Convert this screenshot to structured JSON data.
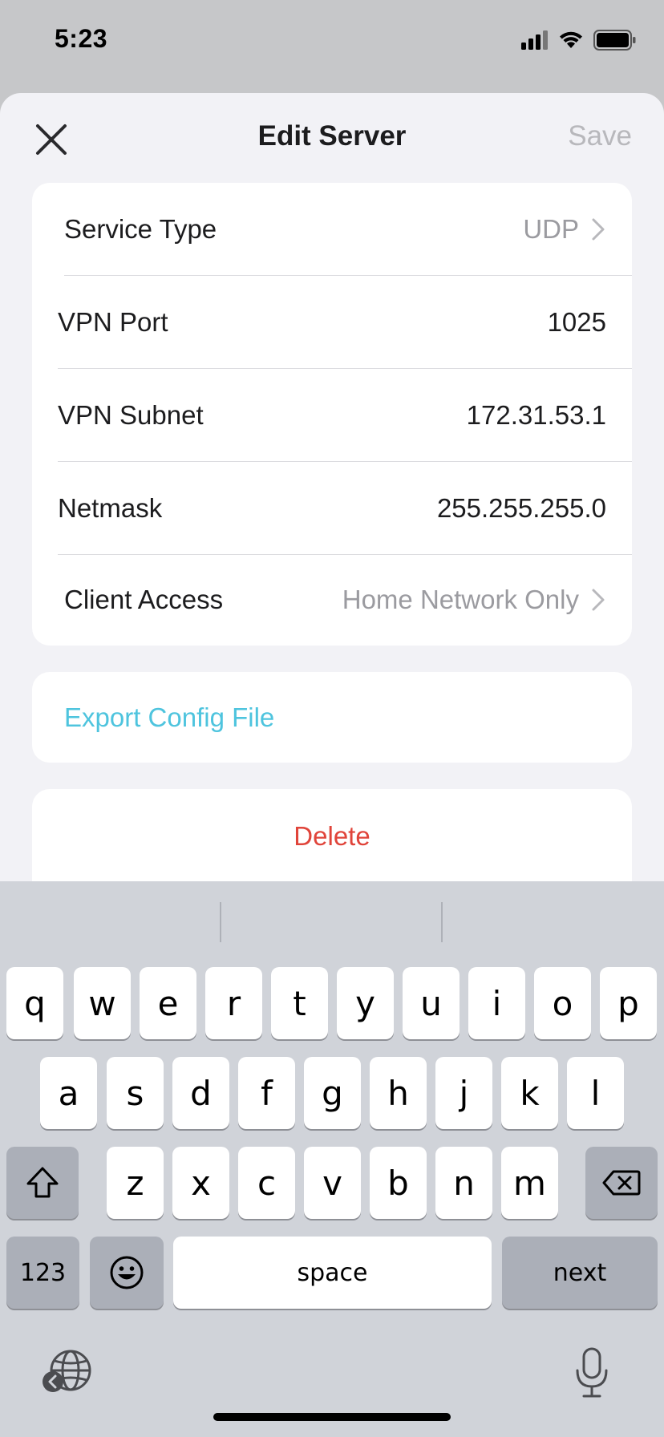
{
  "status": {
    "time": "5:23"
  },
  "nav": {
    "title": "Edit Server",
    "save_label": "Save"
  },
  "settings": [
    {
      "label": "Service Type",
      "value": "UDP",
      "has_chevron": true
    },
    {
      "label": "VPN Port",
      "value": "1025",
      "has_chevron": false
    },
    {
      "label": "VPN Subnet",
      "value": "172.31.53.1",
      "has_chevron": false
    },
    {
      "label": "Netmask",
      "value": "255.255.255.0",
      "has_chevron": false
    },
    {
      "label": "Client Access",
      "value": "Home Network Only",
      "has_chevron": true
    }
  ],
  "export": {
    "label": "Export Config File"
  },
  "delete": {
    "label": "Delete"
  },
  "keyboard": {
    "row1": [
      "q",
      "w",
      "e",
      "r",
      "t",
      "y",
      "u",
      "i",
      "o",
      "p"
    ],
    "row2": [
      "a",
      "s",
      "d",
      "f",
      "g",
      "h",
      "j",
      "k",
      "l"
    ],
    "row3": [
      "z",
      "x",
      "c",
      "v",
      "b",
      "n",
      "m"
    ],
    "numbers_label": "123",
    "space_label": "space",
    "return_label": "next",
    "icons": [
      "shift-icon",
      "delete-icon",
      "emoji-icon",
      "globe-icon",
      "microphone-icon"
    ]
  },
  "colors": {
    "accent": "#4ec4de",
    "danger": "#e0443a",
    "muted": "#9b9ba0",
    "background": "#f2f2f6"
  }
}
